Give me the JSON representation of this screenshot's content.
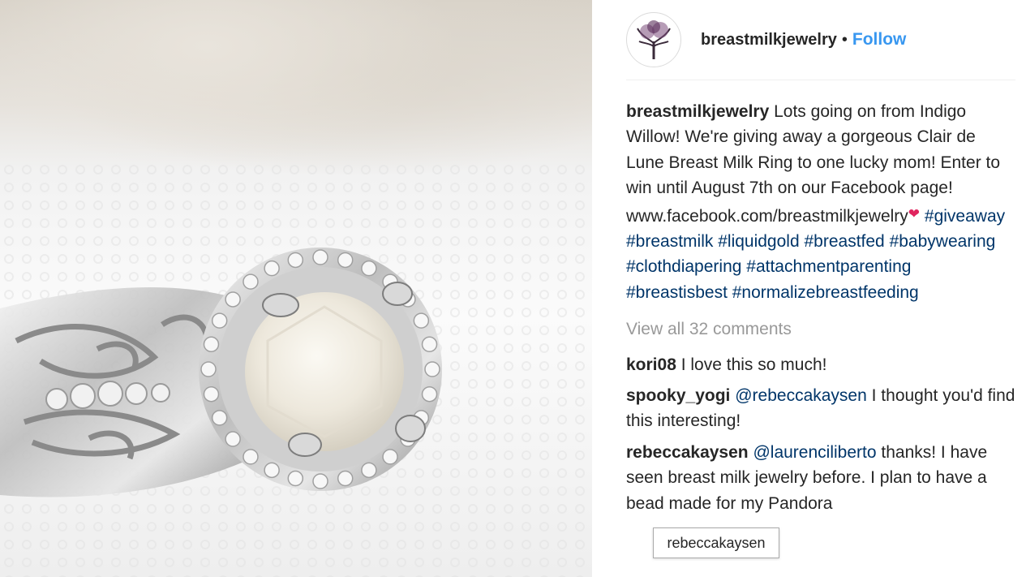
{
  "post": {
    "username": "breastmilkjewelry",
    "dot": "•",
    "follow_label": "Follow",
    "caption": {
      "username": "breastmilkjewelry",
      "text": "Lots going on from Indigo Willow! We're giving away a gorgeous Clair de Lune Breast Milk Ring to one lucky mom! Enter to win until August 7th on our Facebook page!",
      "link": "www.facebook.com/breastmilkjewelry",
      "hashtags": [
        "#giveaway",
        "#breastmilk",
        "#liquidgold",
        "#breastfed",
        "#babywearing",
        "#clothdiapering",
        "#attachmentparenting",
        "#breastisbest",
        "#normalizebreastfeeding"
      ]
    },
    "view_all_label": "View all 32 comments",
    "comments": [
      {
        "username": "kori08",
        "text": "I love this so much!"
      },
      {
        "username": "spooky_yogi",
        "mention": "@rebeccakaysen",
        "text": "I thought you'd find this interesting!"
      },
      {
        "username": "rebeccakaysen",
        "mention": "@laurenciliberto",
        "text": "thanks! I have seen breast milk jewelry before. I plan to have a bead made for my Pandora"
      }
    ],
    "tooltip": "rebeccakaysen"
  },
  "colors": {
    "link_blue": "#3897f0",
    "hashtag": "#003569",
    "muted": "#999999",
    "heart": "#e0245e"
  },
  "icons": {
    "heart": "red-heart-emoji",
    "avatar": "tree-logo-avatar"
  }
}
